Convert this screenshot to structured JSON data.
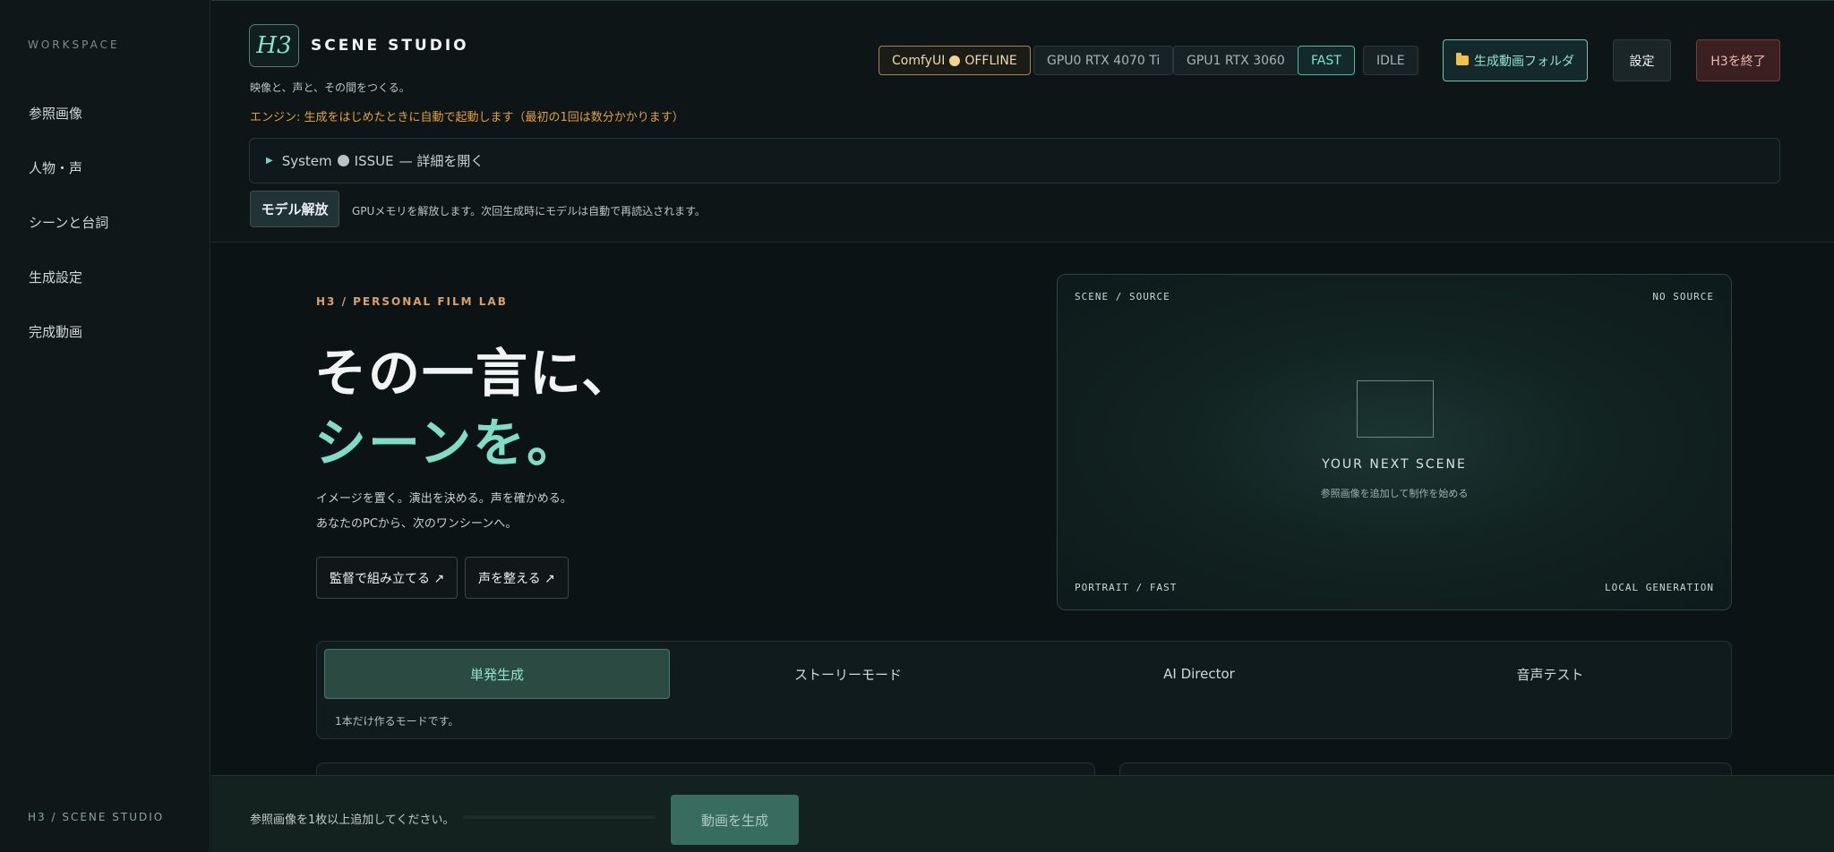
{
  "sidebar": {
    "section_label": "WORKSPACE",
    "items": [
      {
        "label": "参照画像"
      },
      {
        "label": "人物・声"
      },
      {
        "label": "シーンと台詞"
      },
      {
        "label": "生成設定"
      },
      {
        "label": "完成動画"
      }
    ],
    "footer": "H3 / SCENE STUDIO"
  },
  "header": {
    "logo_text": "H3",
    "title": "SCENE STUDIO",
    "tagline": "映像と、声と、その間をつくる。",
    "engine_notice": "エンジン: 生成をはじめたときに自動で起動します（最初の1回は数分かかります）",
    "status": {
      "comfy_label": "ComfyUI",
      "comfy_state": "OFFLINE",
      "gpu0": "GPU0 RTX 4070 Ti",
      "gpu1": "GPU1 RTX 3060",
      "speed": "FAST",
      "state": "IDLE"
    },
    "buttons": {
      "folder": "生成動画フォルダ",
      "settings": "設定",
      "quit": "H3を終了"
    },
    "system": {
      "label": "System",
      "state": "ISSUE",
      "action": "— 詳細を開く"
    },
    "release": {
      "button": "モデル解放",
      "note": "GPUメモリを解放します。次回生成時にモデルは自動で再読込されます。"
    }
  },
  "hero": {
    "eyebrow": "H3 / PERSONAL FILM LAB",
    "line1": "その一言に、",
    "line2": "シーンを。",
    "desc1": "イメージを置く。演出を決める。声を確かめる。",
    "desc2": "あなたのPCから、次のワンシーンへ。",
    "btn_director": "監督で組み立てる ↗",
    "btn_voice": "声を整える ↗"
  },
  "preview": {
    "top_left": "SCENE / SOURCE",
    "top_right": "NO SOURCE",
    "title": "YOUR NEXT SCENE",
    "hint": "参照画像を追加して制作を始める",
    "bottom_left": "PORTRAIT / FAST",
    "bottom_right": "LOCAL GENERATION"
  },
  "modes": {
    "tabs": [
      {
        "label": "単発生成",
        "active": true
      },
      {
        "label": "ストーリーモード"
      },
      {
        "label": "AI Director"
      },
      {
        "label": "音声テスト"
      }
    ],
    "note": "1本だけ作るモードです。"
  },
  "footer": {
    "message": "参照画像を1枚以上追加してください。",
    "progress": 0,
    "generate_button": "動画を生成"
  },
  "colors": {
    "accent": "#7fdcc6",
    "warning": "#e3a13c",
    "danger_bg": "#3a2020",
    "background": "#0c1315"
  }
}
